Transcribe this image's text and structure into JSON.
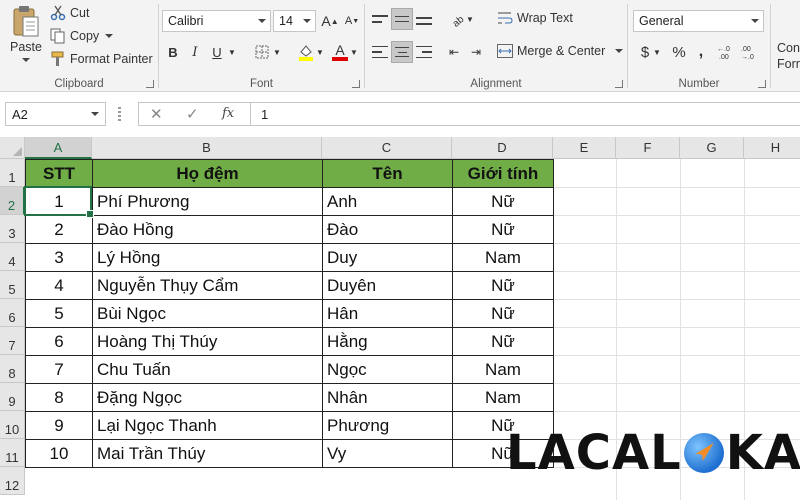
{
  "ribbon": {
    "clipboard": {
      "paste": "Paste",
      "cut": "Cut",
      "copy": "Copy",
      "format_painter": "Format Painter",
      "label": "Clipboard"
    },
    "font": {
      "name": "Calibri",
      "size": "14",
      "bold": "B",
      "italic": "I",
      "underline": "U",
      "label": "Font"
    },
    "alignment": {
      "wrap_text": "Wrap Text",
      "merge_center": "Merge & Center",
      "label": "Alignment"
    },
    "number": {
      "format": "General",
      "currency": "$",
      "percent": "%",
      "comma": ",",
      "label": "Number"
    },
    "styles": {
      "cond_format_line1": "Con",
      "cond_format_line2": "Form"
    }
  },
  "formula_bar": {
    "name_box": "A2",
    "fx": "fx",
    "value": "1"
  },
  "grid": {
    "columns": [
      "A",
      "B",
      "C",
      "D",
      "E",
      "F",
      "G",
      "H"
    ],
    "rows": [
      "1",
      "2",
      "3",
      "4",
      "5",
      "6",
      "7",
      "8",
      "9",
      "10",
      "11",
      "12"
    ],
    "selected_cell": "A2"
  },
  "table": {
    "headers": [
      "STT",
      "Họ đệm",
      "Tên",
      "Giới tính"
    ],
    "rows": [
      [
        "1",
        "Phí Phương",
        "Anh",
        "Nữ"
      ],
      [
        "2",
        "Đào Hồng",
        "Đào",
        "Nữ"
      ],
      [
        "3",
        "Lý Hồng",
        "Duy",
        "Nam"
      ],
      [
        "4",
        "Nguyễn Thụy Cẩm",
        "Duyên",
        "Nữ"
      ],
      [
        "5",
        "Bùi Ngọc",
        "Hân",
        "Nữ"
      ],
      [
        "6",
        "Hoàng Thị Thúy",
        "Hằng",
        "Nữ"
      ],
      [
        "7",
        "Chu Tuấn",
        "Ngọc",
        "Nam"
      ],
      [
        "8",
        "Đặng Ngọc",
        "Nhân",
        "Nam"
      ],
      [
        "9",
        "Lại Ngọc Thanh",
        "Phương",
        "Nữ"
      ],
      [
        "10",
        "Mai Trần Thúy",
        "Vy",
        "Nữ"
      ]
    ]
  },
  "watermark": {
    "part1": "LACAL",
    "part2": "KA"
  },
  "colors": {
    "header_fill": "#70ad47",
    "excel_green": "#217346"
  }
}
